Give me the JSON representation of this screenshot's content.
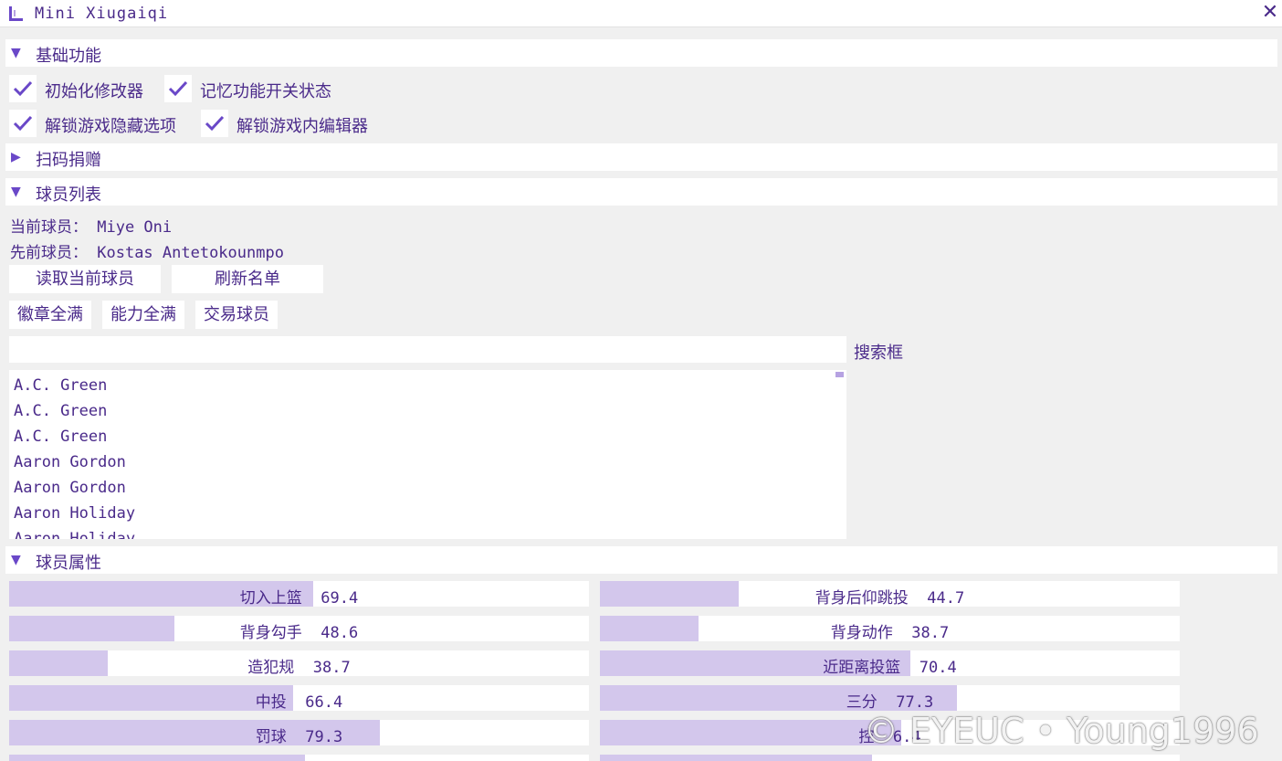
{
  "window": {
    "title": "Mini Xiugaiqi",
    "close": "✕"
  },
  "sections": {
    "basic": {
      "arrow": "▼",
      "label": "基础功能"
    },
    "donate": {
      "arrow": "▶",
      "label": "扫码捐赠"
    },
    "players": {
      "arrow": "▼",
      "label": "球员列表"
    },
    "attrs": {
      "arrow": "▼",
      "label": "球员属性"
    }
  },
  "checks": [
    {
      "label": "初始化修改器",
      "checked": true
    },
    {
      "label": "记忆功能开关状态",
      "checked": true
    },
    {
      "label": "解锁游戏隐藏选项",
      "checked": true
    },
    {
      "label": "解锁游戏内编辑器",
      "checked": true
    }
  ],
  "player_info": {
    "current_key": "当前球员：",
    "current_value": "Miye Oni",
    "previous_key": "先前球员：",
    "previous_value": "Kostas Antetokounmpo"
  },
  "buttons": {
    "read_current": "读取当前球员",
    "refresh_list": "刷新名单",
    "badges_max": "徽章全满",
    "ability_max": "能力全满",
    "trade_player": "交易球员"
  },
  "search": {
    "value": "",
    "placeholder": "",
    "label": "搜索框"
  },
  "player_list": [
    "A.C. Green",
    "A.C. Green",
    "A.C. Green",
    "Aaron Gordon",
    "Aaron Gordon",
    "Aaron Holiday",
    "Aaron Holiday"
  ],
  "attributes": {
    "left": [
      {
        "name": "切入上篮",
        "value": "69.4",
        "fill": 0.525
      },
      {
        "name": "背身勾手",
        "value": "48.6",
        "fill": 0.285
      },
      {
        "name": "造犯规",
        "value": "38.7",
        "fill": 0.17
      },
      {
        "name": "中投",
        "value": "66.4",
        "fill": 0.49
      },
      {
        "name": "罚球",
        "value": "79.3",
        "fill": 0.64
      },
      {
        "name": "",
        "value": "",
        "fill": 0.51
      }
    ],
    "right": [
      {
        "name": "背身后仰跳投",
        "value": "44.7",
        "fill": 0.24
      },
      {
        "name": "背身动作",
        "value": "38.7",
        "fill": 0.17
      },
      {
        "name": "近距离投篮",
        "value": "70.4",
        "fill": 0.535
      },
      {
        "name": "三分",
        "value": "77.3",
        "fill": 0.615
      },
      {
        "name": "控",
        "value": "6.4",
        "fill": 0.52
      },
      {
        "name": "",
        "value": "",
        "fill": 0.47
      }
    ]
  },
  "watermark": "© EYEUC • Young1996",
  "colors": {
    "accent": "#6a48c8",
    "text": "#4a2a8a",
    "bar_fill": "#d3c7ec",
    "background": "#f0f0f0"
  }
}
